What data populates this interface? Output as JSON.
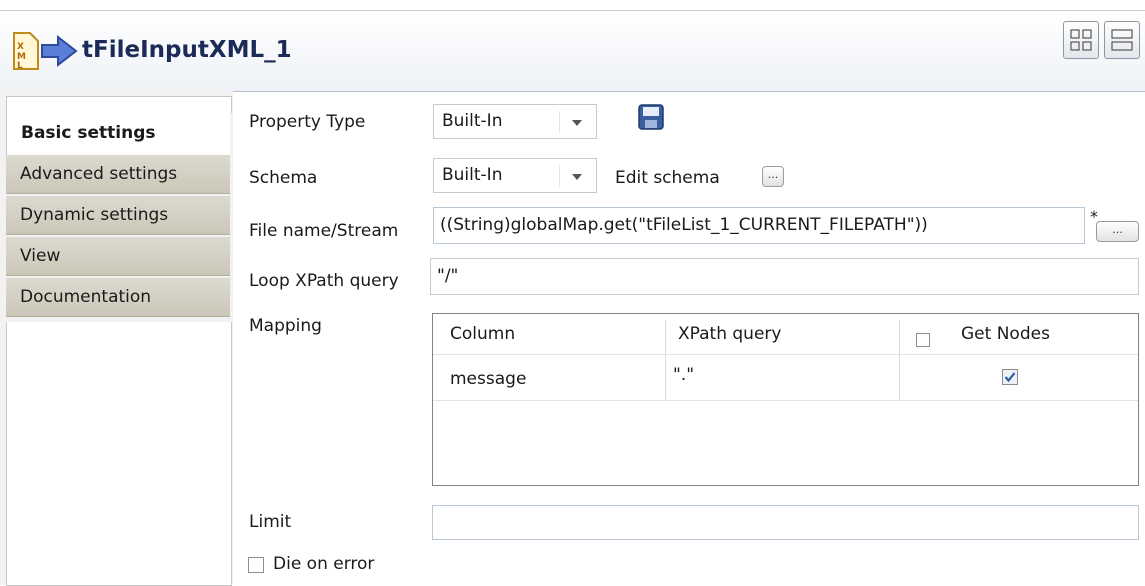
{
  "header": {
    "component_name": "tFileInputXML_1",
    "icon": "component-xml-input-icon",
    "layout_buttons": [
      "two-column-layout-icon",
      "single-column-layout-icon"
    ]
  },
  "sidebar": {
    "tabs": [
      {
        "label": "Basic settings",
        "active": true
      },
      {
        "label": "Advanced settings",
        "active": false
      },
      {
        "label": "Dynamic settings",
        "active": false
      },
      {
        "label": "View",
        "active": false
      },
      {
        "label": "Documentation",
        "active": false
      }
    ]
  },
  "form": {
    "property_type": {
      "label": "Property Type",
      "value": "Built-In"
    },
    "schema": {
      "label": "Schema",
      "value": "Built-In",
      "edit_label": "Edit schema"
    },
    "file_name": {
      "label": "File name/Stream",
      "value": "((String)globalMap.get(\"tFileList_1_CURRENT_FILEPATH\"))",
      "required_marker": "*"
    },
    "loop_xpath": {
      "label": "Loop XPath query",
      "value": "\"/\""
    },
    "mapping": {
      "label": "Mapping",
      "columns": [
        "Column",
        "XPath query",
        "Get Nodes"
      ],
      "get_nodes_header_checked": false,
      "rows": [
        {
          "column": "message",
          "xpath": "\".\"",
          "get_nodes": true
        }
      ]
    },
    "limit": {
      "label": "Limit",
      "value": ""
    },
    "die_on_error": {
      "label": "Die on error",
      "checked": false
    }
  },
  "colors": {
    "title": "#1b2b57",
    "tab_inactive": "#cbc7b8",
    "checkbox_check": "#2a5caa"
  }
}
